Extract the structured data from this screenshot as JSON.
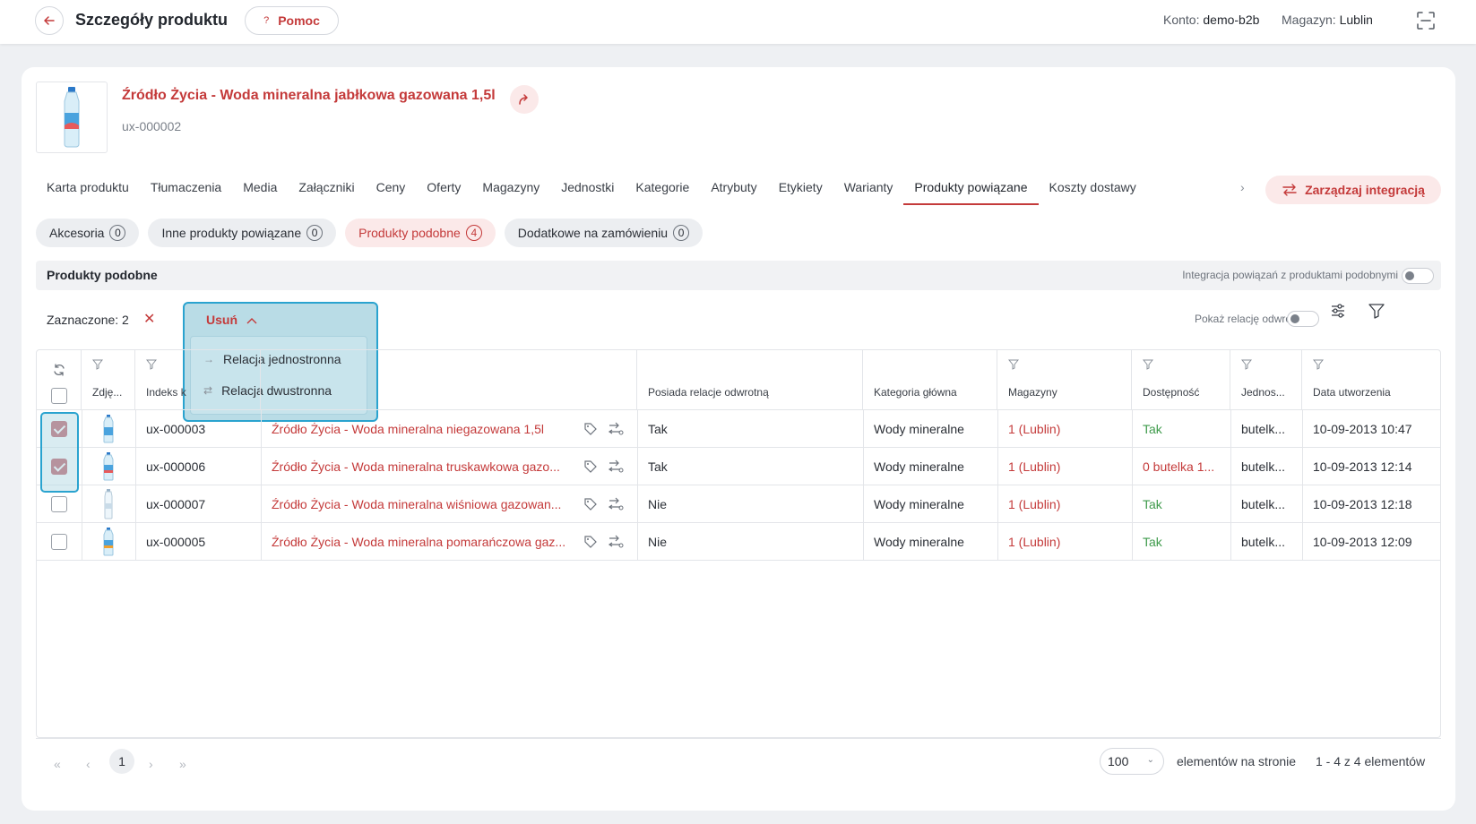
{
  "header": {
    "title": "Szczegóły produktu",
    "help_label": "Pomoc",
    "help_icon": "?",
    "account_label": "Konto:",
    "account_value": "demo-b2b",
    "warehouse_label": "Magazyn:",
    "warehouse_value": "Lublin"
  },
  "product": {
    "name": "Źródło Życia - Woda mineralna jabłkowa gazowana 1,5l",
    "code": "ux-000002"
  },
  "tabs": [
    {
      "label": "Karta produktu"
    },
    {
      "label": "Tłumaczenia"
    },
    {
      "label": "Media"
    },
    {
      "label": "Załączniki"
    },
    {
      "label": "Ceny"
    },
    {
      "label": "Oferty"
    },
    {
      "label": "Magazyny"
    },
    {
      "label": "Jednostki"
    },
    {
      "label": "Kategorie"
    },
    {
      "label": "Atrybuty"
    },
    {
      "label": "Etykiety"
    },
    {
      "label": "Warianty"
    },
    {
      "label": "Produkty powiązane",
      "active": true
    },
    {
      "label": "Koszty dostawy"
    }
  ],
  "integration_button": "Zarządzaj integracją",
  "chips": [
    {
      "label": "Akcesoria",
      "count": "0"
    },
    {
      "label": "Inne produkty powiązane",
      "count": "0"
    },
    {
      "label": "Produkty podobne",
      "count": "4",
      "active": true
    },
    {
      "label": "Dodatkowe na zamówieniu",
      "count": "0"
    }
  ],
  "section": {
    "title": "Produkty podobne",
    "integration_toggle_label": "Integracja powiązań z produktami podobnymi"
  },
  "toolbar": {
    "selected_label": "Zaznaczone: 2",
    "clear_icon": "✕",
    "delete_label": "Usuń",
    "reverse_label": "Pokaż relację odwrotną"
  },
  "delete_menu": [
    {
      "label": "Relacja jednostronna",
      "icon": "→"
    },
    {
      "label": "Relacja dwustronna",
      "icon": "⇄"
    }
  ],
  "table": {
    "columns": {
      "photo": "Zdję...",
      "index": "Indeks k",
      "reverse": "Posiada relacje odwrotną",
      "category": "Kategoria główna",
      "warehouses": "Magazyny",
      "availability": "Dostępność",
      "unit": "Jednos...",
      "created": "Data utworzenia"
    },
    "rows": [
      {
        "checked": true,
        "index": "ux-000003",
        "name": "Źródło Życia - Woda mineralna niegazowana 1,5l",
        "reverse": "Tak",
        "category": "Wody mineralne",
        "warehouses": "1 (Lublin)",
        "availability": "Tak",
        "availability_status": "ok",
        "unit": "butelk...",
        "created": "10-09-2013 10:47"
      },
      {
        "checked": true,
        "index": "ux-000006",
        "name": "Źródło Życia - Woda mineralna truskawkowa gazo...",
        "reverse": "Tak",
        "category": "Wody mineralne",
        "warehouses": "1 (Lublin)",
        "availability": "0 butelka 1...",
        "availability_status": "none",
        "unit": "butelk...",
        "created": "10-09-2013 12:14"
      },
      {
        "checked": false,
        "index": "ux-000007",
        "name": "Źródło Życia - Woda mineralna wiśniowa gazowan...",
        "reverse": "Nie",
        "category": "Wody mineralne",
        "warehouses": "1 (Lublin)",
        "availability": "Tak",
        "availability_status": "ok",
        "unit": "butelk...",
        "created": "10-09-2013 12:18"
      },
      {
        "checked": false,
        "index": "ux-000005",
        "name": "Źródło Życia - Woda mineralna pomarańczowa gaz...",
        "reverse": "Nie",
        "category": "Wody mineralne",
        "warehouses": "1 (Lublin)",
        "availability": "Tak",
        "availability_status": "ok",
        "unit": "butelk...",
        "created": "10-09-2013 12:09"
      }
    ]
  },
  "pagination": {
    "first": "«",
    "prev": "‹",
    "current_page": "1",
    "next": "›",
    "last": "»",
    "per_page": "100",
    "per_page_label": "elementów na stronie",
    "total_label": "1 - 4 z 4 elementów"
  },
  "colors": {
    "accent": "#c43a3a",
    "checkbox_checked": "#b23a48",
    "highlight": "#2aa3cf",
    "available": "#3f9b4c"
  }
}
